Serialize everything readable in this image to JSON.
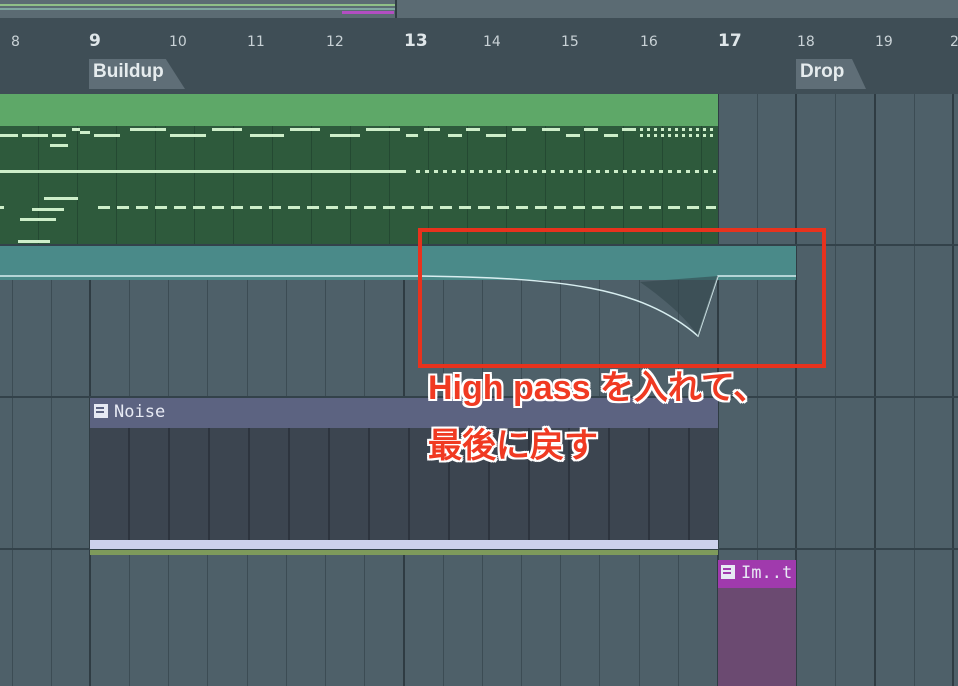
{
  "ruler": {
    "bars": [
      {
        "label": "8",
        "major": false
      },
      {
        "label": "9",
        "major": true
      },
      {
        "label": "10",
        "major": false
      },
      {
        "label": "11",
        "major": false
      },
      {
        "label": "12",
        "major": false
      },
      {
        "label": "13",
        "major": true
      },
      {
        "label": "14",
        "major": false
      },
      {
        "label": "15",
        "major": false
      },
      {
        "label": "16",
        "major": false
      },
      {
        "label": "17",
        "major": true
      },
      {
        "label": "18",
        "major": false
      },
      {
        "label": "19",
        "major": false
      },
      {
        "label": "2",
        "major": false
      }
    ],
    "markers": {
      "buildup": "Buildup",
      "drop": "Drop"
    }
  },
  "clips": {
    "noise": {
      "label": "Noise"
    },
    "im": {
      "label": "Im..t"
    }
  },
  "annotation": {
    "line1": "High pass を入れて、",
    "line2": "最後に戻す",
    "color": "#e8321d"
  }
}
